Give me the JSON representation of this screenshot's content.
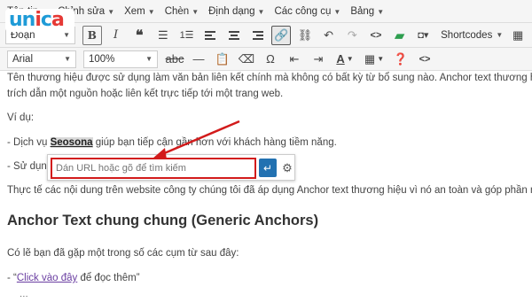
{
  "menubar": {
    "items": [
      "Tệp tin",
      "Chỉnh sửa",
      "Xem",
      "Chèn",
      "Định dạng",
      "Các công cụ",
      "Bảng"
    ]
  },
  "toolbar1": {
    "format_select": "Đoạn",
    "bold_label": "B",
    "shortcodes_label": "Shortcodes"
  },
  "toolbar2": {
    "font_select": "Arial",
    "size_select": "100%",
    "text_color_label": "A"
  },
  "content": {
    "p1_line1": "Tên thương hiệu được sử dụng làm văn bản liên kết chính mà không có bất kỳ từ bổ sung nào. Anchor text thương hiệu",
    "p1_line2": "trích dẫn một nguồn hoặc liên kết trực tiếp tới một trang web.",
    "p2": "Ví dụ:",
    "p3_pre": "- Dịch vụ ",
    "p3_highlight": "Seosona",
    "p3_post": " giúp bạn tiếp cận gần hơn với khách hàng tiềm năng.",
    "p4_pre": "- Sử dụng",
    "p5": "Thực tế các nội dung trên website công ty chúng tôi đã áp dụng Anchor text thương hiệu vì nó an toàn và góp phần nâng",
    "heading": "Anchor Text chung chung (Generic Anchors)",
    "p6": "Có lẽ bạn đã gặp một trong số các cụm từ sau đây:",
    "p7_pre": "- “",
    "p7_link": "Click vào đây",
    "p7_post": " để đọc thêm”"
  },
  "link_popup": {
    "placeholder": "Dán URL hoặc gõ để tìm kiếm",
    "apply_icon": "enter-icon",
    "settings_icon": "gear-icon",
    "border_color": "#d21b1b",
    "apply_color": "#2271b1"
  },
  "logo": {
    "text": "unica"
  }
}
